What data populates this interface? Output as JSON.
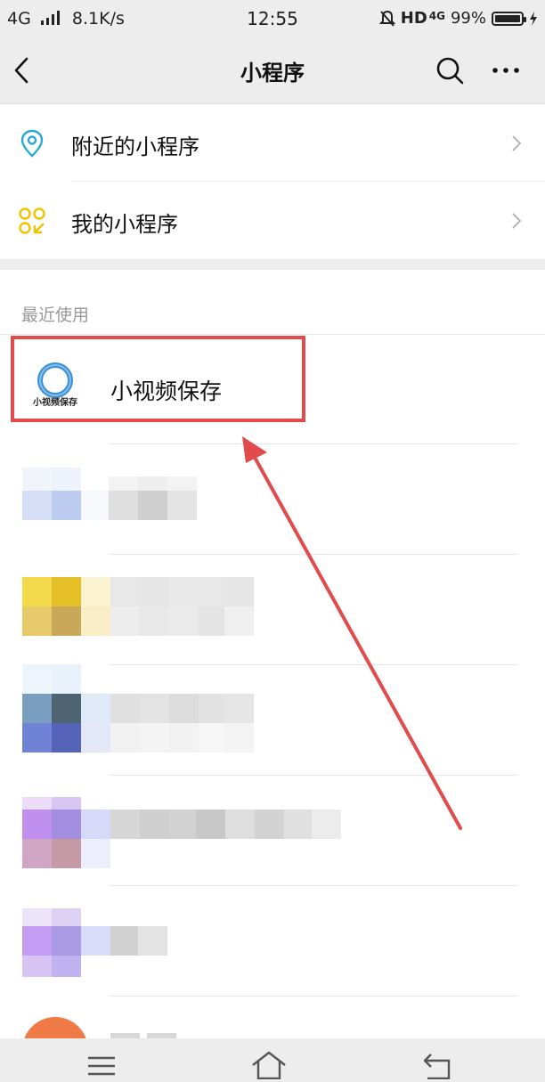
{
  "status_bar": {
    "left": "4G      8.1K/s",
    "network": "4G",
    "speed": "8.1K/s",
    "time": "12:55",
    "hd": "HD",
    "net2": "4G",
    "battery": "99%",
    "battery_level": 0.99
  },
  "navbar": {
    "title": "小程序",
    "back_icon": "back-icon",
    "search_icon": "search-icon",
    "more_icon": "more-icon"
  },
  "menu": {
    "items": [
      {
        "label": "附近的小程序",
        "icon": "location-pin-icon"
      },
      {
        "label": "我的小程序",
        "icon": "miniprogram-grid-icon"
      }
    ]
  },
  "recent": {
    "section_title": "最近使用",
    "items": [
      {
        "name": "小视频保存",
        "logo_text": "小视频保存",
        "logo_color": "#3a8fd6"
      }
    ]
  },
  "colors": {
    "highlight": "#e14b4b",
    "bar_bg": "#ededed",
    "accent_blue": "#2ba7d6",
    "accent_yellow": "#f2c300"
  },
  "bottom_bar": {
    "icons": [
      "menu-icon",
      "home-icon",
      "return-icon"
    ]
  }
}
